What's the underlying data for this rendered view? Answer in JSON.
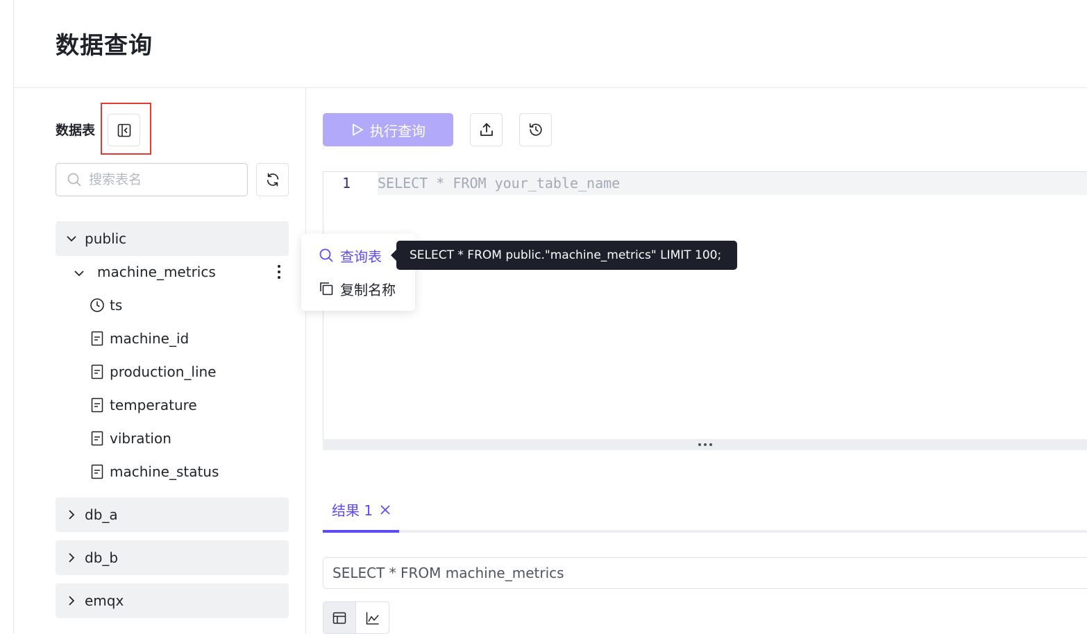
{
  "page": {
    "title": "数据查询"
  },
  "sidebar": {
    "label": "数据表",
    "search_placeholder": "搜索表名",
    "tree": {
      "db_public": "public",
      "table": "machine_metrics",
      "columns": [
        "ts",
        "machine_id",
        "production_line",
        "temperature",
        "vibration",
        "machine_status"
      ],
      "other_dbs": [
        "db_a",
        "db_b",
        "emqx"
      ]
    }
  },
  "context_menu": {
    "query_table": "查询表",
    "copy_name": "复制名称",
    "tooltip": "SELECT * FROM public.\"machine_metrics\" LIMIT 100;"
  },
  "toolbar": {
    "run_label": "执行查询"
  },
  "editor": {
    "line_number": "1",
    "placeholder": "SELECT * FROM your_table_name"
  },
  "results": {
    "tab_label": "结果 1",
    "sql": "SELECT * FROM machine_metrics"
  },
  "colors": {
    "accent": "#5b4cf5",
    "run_button_disabled": "#b3a9fb",
    "tooltip_bg": "#1d1f2b",
    "highlight": "#e53935"
  }
}
